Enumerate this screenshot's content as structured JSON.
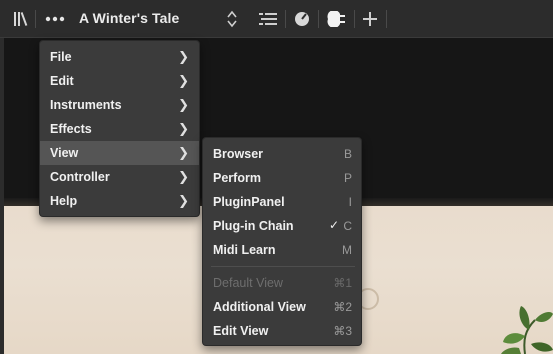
{
  "toolbar": {
    "library_icon": "library-icon",
    "more_icon": "more-dots-icon",
    "title": "A Winter's Tale",
    "updown_icon": "up-down-arrows-icon",
    "list_icon": "list-lines-icon",
    "clock_icon": "gauge-icon",
    "plug_icon": "plug-icon",
    "add_icon": "plus-icon"
  },
  "main_menu": {
    "items": [
      {
        "label": "File"
      },
      {
        "label": "Edit"
      },
      {
        "label": "Instruments"
      },
      {
        "label": "Effects"
      },
      {
        "label": "View"
      },
      {
        "label": "Controller"
      },
      {
        "label": "Help"
      }
    ],
    "active": "View"
  },
  "view_submenu": {
    "items": [
      {
        "label": "Browser",
        "shortcut": "B"
      },
      {
        "label": "Perform",
        "shortcut": "P"
      },
      {
        "label": "PluginPanel",
        "shortcut": "I"
      },
      {
        "label": "Plug-in Chain",
        "shortcut": "C",
        "check": "✓"
      },
      {
        "label": "Midi Learn",
        "shortcut": "M"
      },
      {
        "label": "Default View",
        "shortcut": "⌘1"
      },
      {
        "label": "Additional View",
        "shortcut": "⌘2"
      },
      {
        "label": "Edit View",
        "shortcut": "⌘3"
      }
    ]
  },
  "colors": {
    "toolbar_bg": "#2c2c2c",
    "menu_bg": "#3b3b3b",
    "menu_active": "#555555",
    "wall": "#e9dccd"
  }
}
